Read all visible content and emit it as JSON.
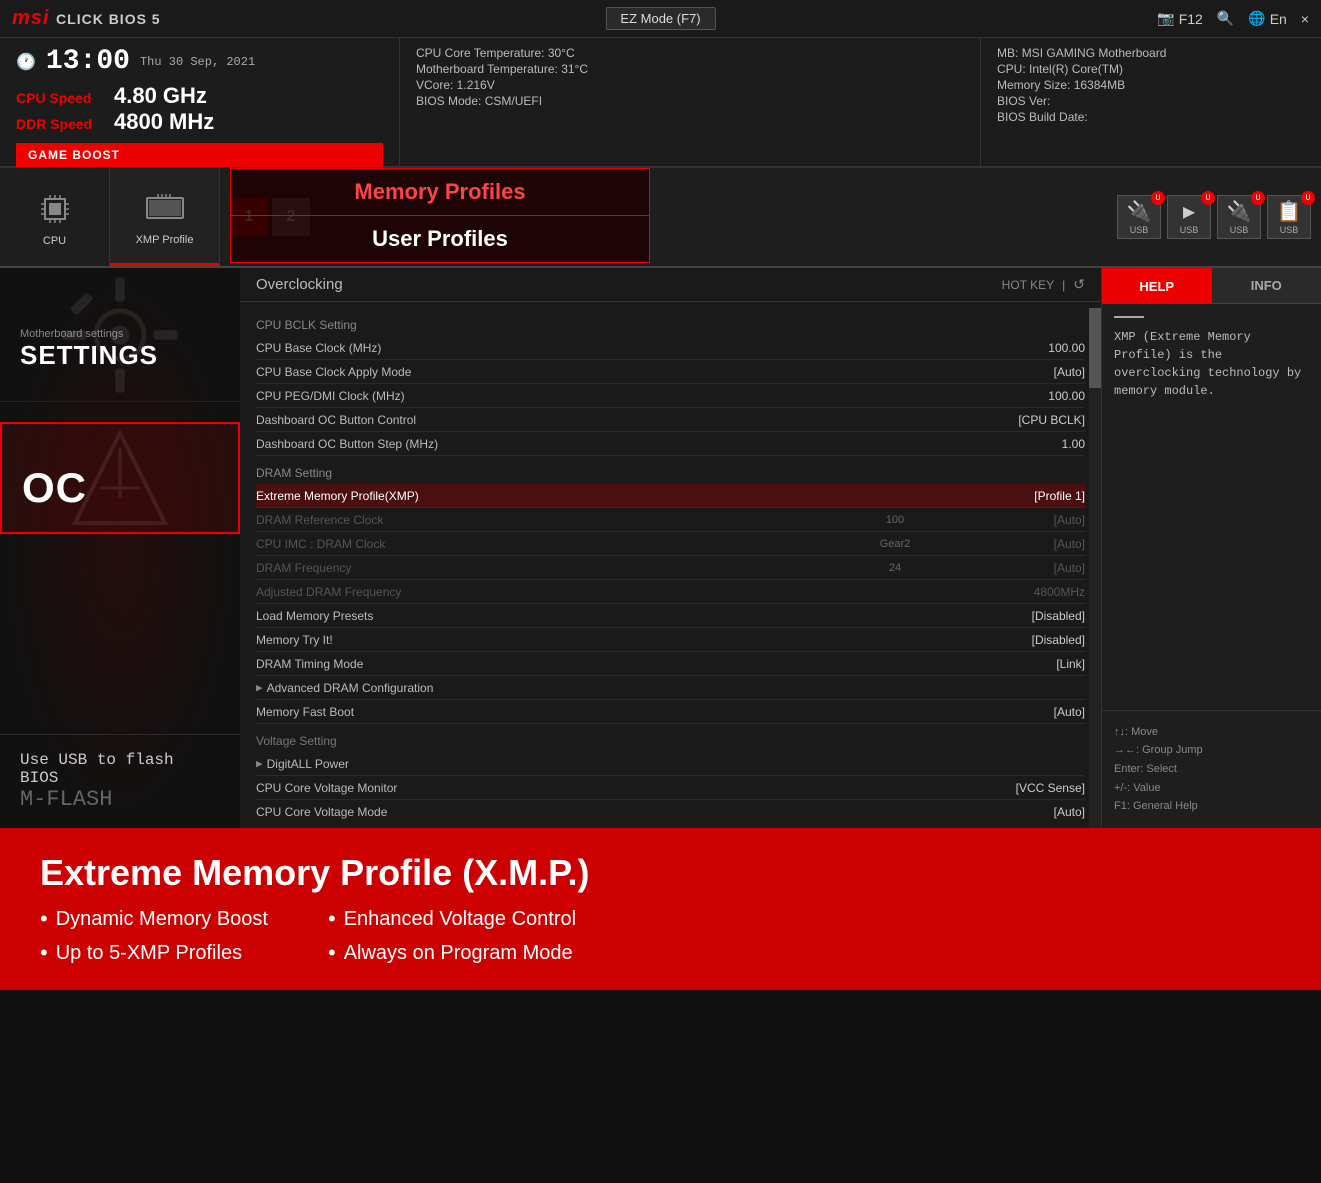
{
  "topbar": {
    "logo": "MSI CLICK BIOS 5",
    "ez_mode_label": "EZ Mode (F7)",
    "f12_label": "F12",
    "lang_label": "En",
    "close_label": "×"
  },
  "infobar": {
    "clock": "13:00",
    "date": "Thu 30 Sep, 2021",
    "cpu_speed_label": "CPU Speed",
    "cpu_speed_value": "4.80 GHz",
    "ddr_speed_label": "DDR Speed",
    "ddr_speed_value": "4800 MHz",
    "game_boost_label": "GAME BOOST",
    "cpu_temp": "CPU Core Temperature: 30°C",
    "mb_temp": "Motherboard Temperature: 31°C",
    "vcore": "VCore: 1.216V",
    "bios_mode": "BIOS Mode: CSM/UEFI",
    "mb_label": "MB:",
    "mb_value": "MSI GAMING Motherboard",
    "cpu_label": "CPU:",
    "cpu_value": "Intel(R) Core(TM)",
    "memory_label": "Memory Size:",
    "memory_value": "16384MB",
    "bios_ver_label": "BIOS Ver:",
    "bios_ver_value": "",
    "bios_build_label": "BIOS Build Date:",
    "bios_build_value": ""
  },
  "nav": {
    "items": [
      {
        "label": "CPU",
        "icon": "⊞"
      },
      {
        "label": "XMP Profile",
        "icon": "▦"
      }
    ],
    "xmp_btn1": "1",
    "xmp_btn2": "2",
    "profile_dropdown": [
      {
        "label": "Memory Profiles"
      },
      {
        "label": "User Profiles"
      }
    ],
    "usb_items": [
      {
        "label": "USB",
        "badge": "U"
      },
      {
        "label": "USB",
        "badge": "U"
      },
      {
        "label": "USB",
        "badge": "U"
      },
      {
        "label": "USB",
        "badge": "U"
      }
    ]
  },
  "left_panel": {
    "settings_sub": "Motherboard settings",
    "settings_title": "SETTINGS",
    "oc_sub": "",
    "oc_title": "OC",
    "mflash_sub": "Use USB to flash BIOS",
    "mflash_title": "M-FLASH"
  },
  "center": {
    "title": "Overclocking",
    "hotkey": "HOT KEY",
    "sections": [
      {
        "header": "CPU BCLK Setting",
        "rows": [
          {
            "name": "CPU Base Clock (MHz)",
            "sub": "",
            "value": "100.00",
            "state": "normal"
          },
          {
            "name": "CPU Base Clock Apply Mode",
            "sub": "",
            "value": "[Auto]",
            "state": "normal"
          },
          {
            "name": "CPU PEG/DMI Clock (MHz)",
            "sub": "",
            "value": "100.00",
            "state": "normal"
          },
          {
            "name": "Dashboard OC Button Control",
            "sub": "",
            "value": "[CPU BCLK]",
            "state": "normal"
          },
          {
            "name": "Dashboard OC Button Step (MHz)",
            "sub": "",
            "value": "1.00",
            "state": "normal"
          }
        ]
      },
      {
        "header": "DRAM Setting",
        "rows": [
          {
            "name": "Extreme Memory Profile(XMP)",
            "sub": "",
            "value": "[Profile 1]",
            "state": "highlighted"
          },
          {
            "name": "DRAM Reference Clock",
            "sub": "100",
            "value": "[Auto]",
            "state": "disabled"
          },
          {
            "name": "CPU IMC : DRAM Clock",
            "sub": "Gear2",
            "value": "[Auto]",
            "state": "disabled"
          },
          {
            "name": "DRAM Frequency",
            "sub": "24",
            "value": "[Auto]",
            "state": "disabled"
          },
          {
            "name": "Adjusted DRAM Frequency",
            "sub": "",
            "value": "4800MHz",
            "state": "disabled"
          },
          {
            "name": "Load Memory Presets",
            "sub": "",
            "value": "[Disabled]",
            "state": "normal"
          },
          {
            "name": "Memory Try It!",
            "sub": "",
            "value": "[Disabled]",
            "state": "normal"
          },
          {
            "name": "DRAM Timing Mode",
            "sub": "",
            "value": "[Link]",
            "state": "normal"
          },
          {
            "name": "Advanced DRAM Configuration",
            "sub": "",
            "value": "",
            "state": "arrow"
          },
          {
            "name": "Memory Fast Boot",
            "sub": "",
            "value": "[Auto]",
            "state": "normal"
          }
        ]
      },
      {
        "header": "Voltage Setting",
        "rows": [
          {
            "name": "DigitALL Power",
            "sub": "",
            "value": "",
            "state": "arrow"
          },
          {
            "name": "CPU Core Voltage Monitor",
            "sub": "",
            "value": "[VCC Sense]",
            "state": "normal"
          },
          {
            "name": "CPU Core Voltage Mode",
            "sub": "",
            "value": "[Auto]",
            "state": "normal"
          }
        ]
      }
    ]
  },
  "right_panel": {
    "help_tab": "HELP",
    "info_tab": "INFO",
    "help_text": "XMP (Extreme Memory Profile) is the overclocking technology by memory module.",
    "keys": [
      "↑↓: Move",
      "→←: Group Jump",
      "Enter: Select",
      "+/-: Value",
      "F1: General Help"
    ]
  },
  "bottom": {
    "title": "Extreme Memory Profile (X.M.P.)",
    "features_left": [
      "Dynamic Memory Boost",
      "Up to 5-XMP Profiles"
    ],
    "features_right": [
      "Enhanced Voltage Control",
      "Always on Program Mode"
    ]
  }
}
